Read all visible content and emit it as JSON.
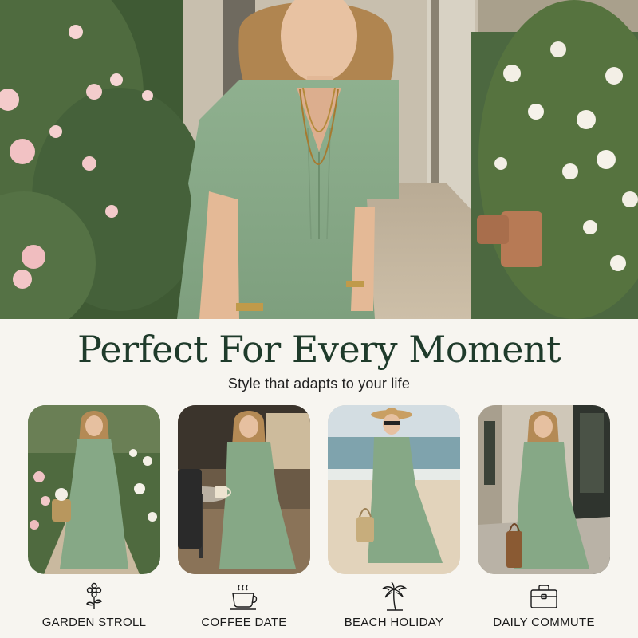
{
  "headline": {
    "title": "Perfect For Every Moment",
    "subtitle": "Style that adapts to your life"
  },
  "moments": [
    {
      "label": "GARDEN STROLL",
      "icon": "flower-icon"
    },
    {
      "label": "COFFEE DATE",
      "icon": "coffee-cup-icon"
    },
    {
      "label": "BEACH HOLIDAY",
      "icon": "palm-tree-icon"
    },
    {
      "label": "DAILY COMMUTE",
      "icon": "briefcase-icon"
    }
  ],
  "colors": {
    "background": "#f7f5f0",
    "title": "#1f3b2b",
    "dress": "#8fb08f",
    "text": "#1a1a1a"
  }
}
